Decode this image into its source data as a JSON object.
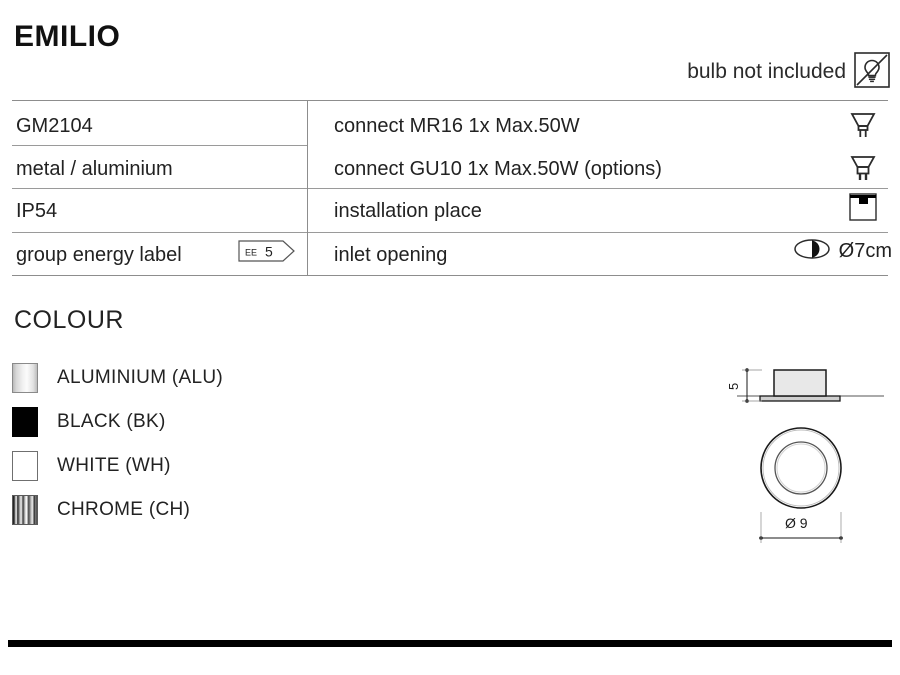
{
  "header": {
    "title": "EMILIO",
    "bulb_note": "bulb not included",
    "bulb_note_icon": "no-bulb-icon"
  },
  "spec_table": {
    "rows": [
      {
        "left": "GM2104",
        "right": "connect MR16 1x Max.50W",
        "icon": "mr16-lamp-icon"
      },
      {
        "left": "metal / aluminium",
        "right": "connect GU10 1x Max.50W (options)",
        "icon": "gu10-lamp-icon"
      },
      {
        "left": "IP54",
        "right": "installation place",
        "icon": "ceiling-mount-icon"
      },
      {
        "left": "group energy label",
        "right": "inlet opening",
        "icon": "inlet-opening-icon",
        "badge_small": "EE",
        "badge_value": "5",
        "dimension": "Ø7cm"
      }
    ]
  },
  "colour": {
    "title": "COLOUR",
    "items": [
      {
        "label": "ALUMINIUM (ALU)",
        "swatch": "aluminium",
        "hex": "#d8d8d8"
      },
      {
        "label": "BLACK (BK)",
        "swatch": "black",
        "hex": "#010101"
      },
      {
        "label": "WHITE (WH)",
        "swatch": "white",
        "hex": "#ffffff"
      },
      {
        "label": "CHROME (CH)",
        "swatch": "chrome",
        "hex": "#9a9a9a"
      }
    ]
  },
  "technical_drawing": {
    "height_dimension": "5",
    "diameter_dimension": "Ø 9"
  }
}
